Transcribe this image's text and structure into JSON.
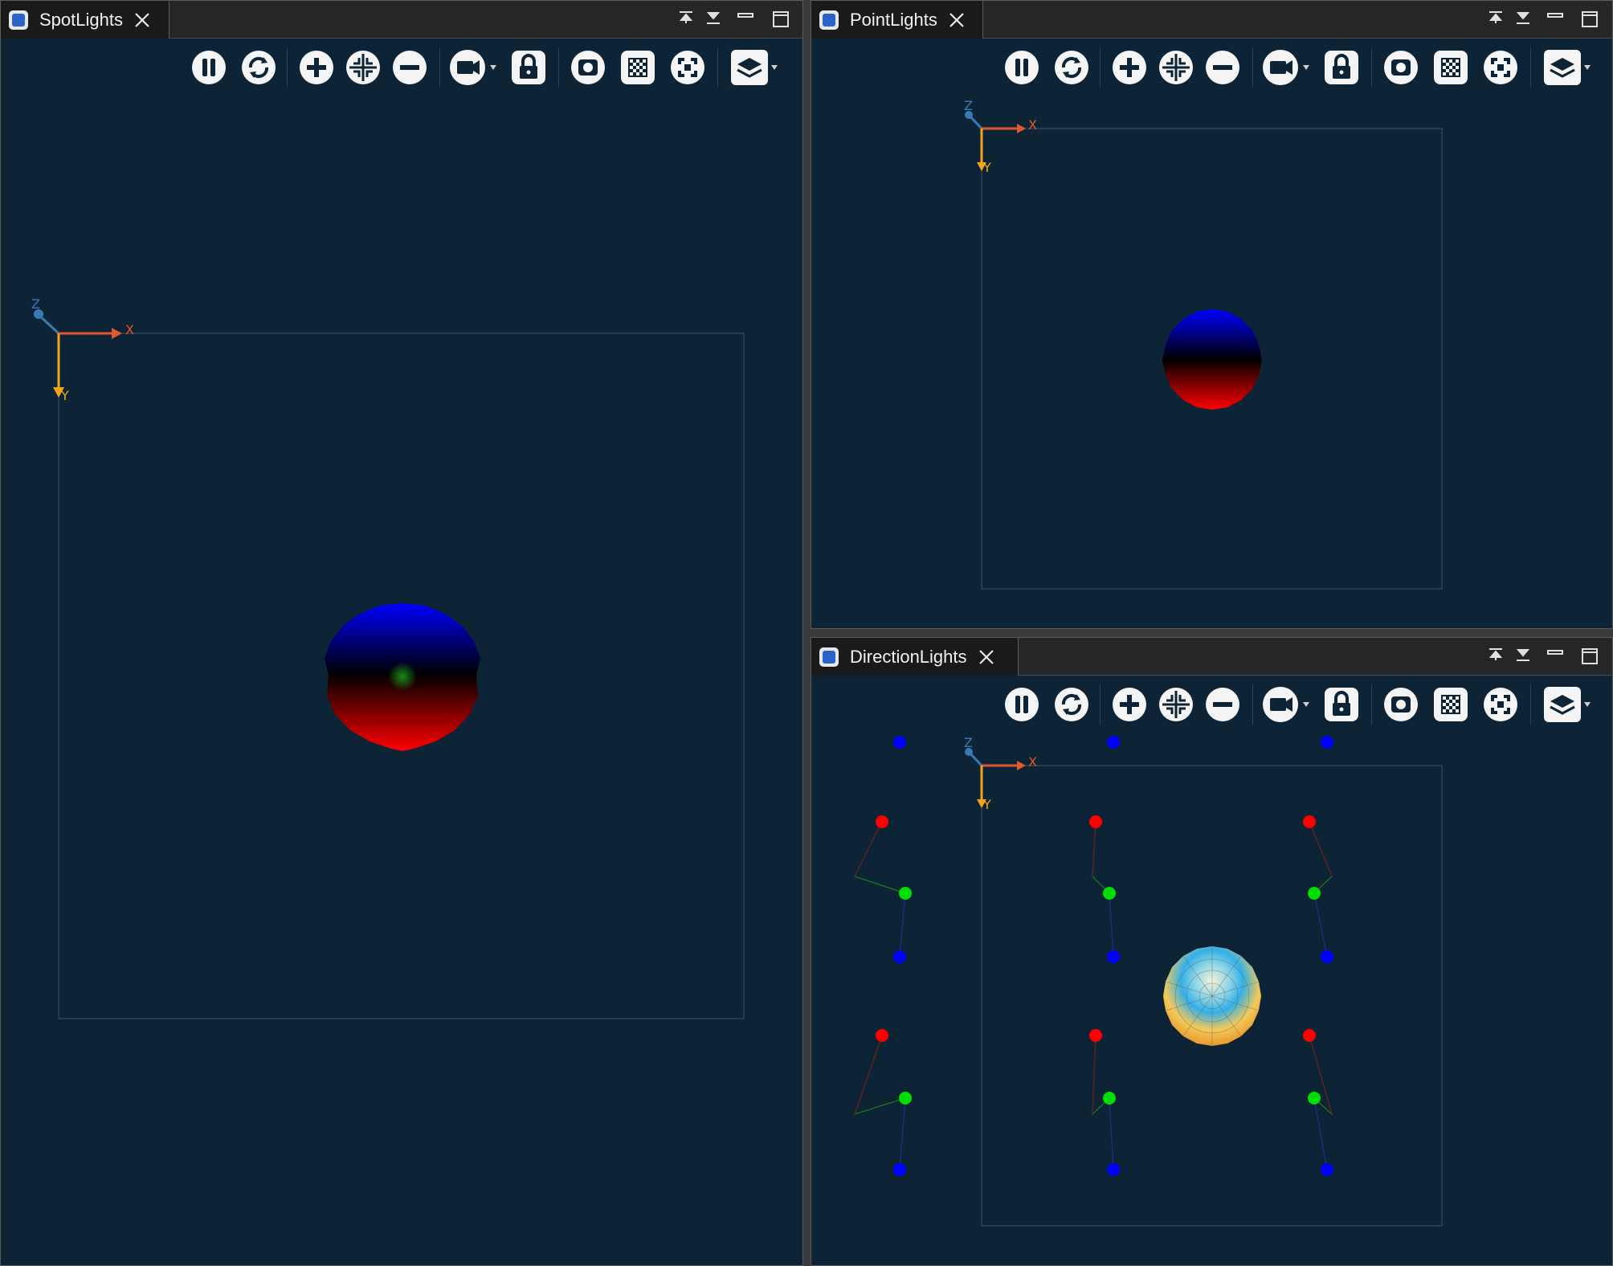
{
  "panes": {
    "spotlights": {
      "title": "SpotLights"
    },
    "pointlights": {
      "title": "PointLights"
    },
    "directionlights": {
      "title": "DirectionLights"
    }
  },
  "axes": {
    "x": "X",
    "y": "Y",
    "z": "Z"
  },
  "toolbar": {
    "buttons": [
      "pause-icon",
      "refresh-icon",
      "zoom-in-icon",
      "zoom-fit-icon",
      "zoom-out-icon",
      "camera-icon",
      "lock-icon",
      "screenshot-icon",
      "checkerboard-icon",
      "fullscreen-icon",
      "layers-icon"
    ]
  },
  "colors": {
    "background": "#0d2436",
    "axis_x": "#e2572b",
    "axis_y": "#f2a51a",
    "axis_z": "#3a79b5",
    "light_red": "#ff0000",
    "light_green": "#00dd00",
    "light_blue": "#0000ff"
  }
}
